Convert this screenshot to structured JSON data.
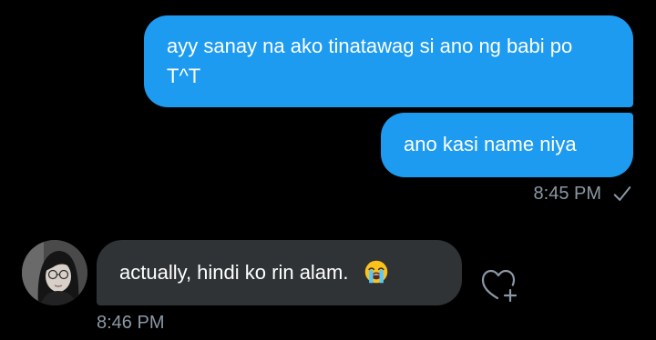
{
  "messages": {
    "outgoing": [
      {
        "text": "ayy sanay na ako tinatawag si ano ng babi po T^T"
      },
      {
        "text": "ano kasi name niya"
      }
    ],
    "outgoing_time": "8:45 PM",
    "outgoing_status_icon": "check-icon",
    "incoming": {
      "text": "actually, hindi ko rin alam.",
      "emoji": "loudly-crying-face",
      "time": "8:46 PM",
      "avatar": "avatar"
    }
  },
  "actions": {
    "react_icon": "heart-plus-icon"
  },
  "colors": {
    "background": "#000000",
    "outgoing_bubble": "#1d9bf0",
    "incoming_bubble": "#2f3336",
    "timestamp": "#8b98a5"
  }
}
